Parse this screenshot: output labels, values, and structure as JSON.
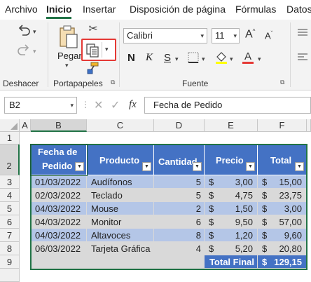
{
  "menu": [
    "Archivo",
    "Inicio",
    "Insertar",
    "Disposición de página",
    "Fórmulas",
    "Datos"
  ],
  "ribbon": {
    "undo_group": "Deshacer",
    "paste_label": "Pegar",
    "clipboard_group": "Portapapeles",
    "font_name": "Calibri",
    "font_size": "11",
    "font_group": "Fuente",
    "bold": "N",
    "italic": "K",
    "underline": "S",
    "grow_font": "A",
    "shrink_font": "A"
  },
  "formula_bar": {
    "name_box": "B2",
    "fx": "fx",
    "content": "Fecha de Pedido"
  },
  "columns": [
    "A",
    "B",
    "C",
    "D",
    "E",
    "F"
  ],
  "rows": [
    "1",
    "2",
    "3",
    "4",
    "5",
    "6",
    "7",
    "8",
    "9"
  ],
  "table": {
    "headers": [
      "Fecha de Pedido",
      "Producto",
      "Cantidad",
      "Precio",
      "Total"
    ],
    "header_date_line1": "Fecha de",
    "header_date_line2": "Pedido",
    "rows": [
      {
        "date": "01/03/2022",
        "product": "Audífonos",
        "qty": "5",
        "price": "3,00",
        "total": "15,00"
      },
      {
        "date": "02/03/2022",
        "product": "Teclado",
        "qty": "5",
        "price": "4,75",
        "total": "23,75"
      },
      {
        "date": "04/03/2022",
        "product": "Mouse",
        "qty": "2",
        "price": "1,50",
        "total": "3,00"
      },
      {
        "date": "04/03/2022",
        "product": "Monitor",
        "qty": "6",
        "price": "9,50",
        "total": "57,00"
      },
      {
        "date": "04/03/2022",
        "product": "Altavoces",
        "qty": "8",
        "price": "1,20",
        "total": "9,60"
      },
      {
        "date": "06/03/2022",
        "product": "Tarjeta Gráfica",
        "qty": "4",
        "price": "5,20",
        "total": "20,80"
      }
    ],
    "currency": "$",
    "total_label": "Total Final",
    "total_value": "129,15"
  },
  "colors": {
    "header": "#4472c4",
    "band_blue": "#b4c6e7",
    "band_gray": "#d9d9d9",
    "accent": "#217346",
    "highlight": "#e53935"
  }
}
